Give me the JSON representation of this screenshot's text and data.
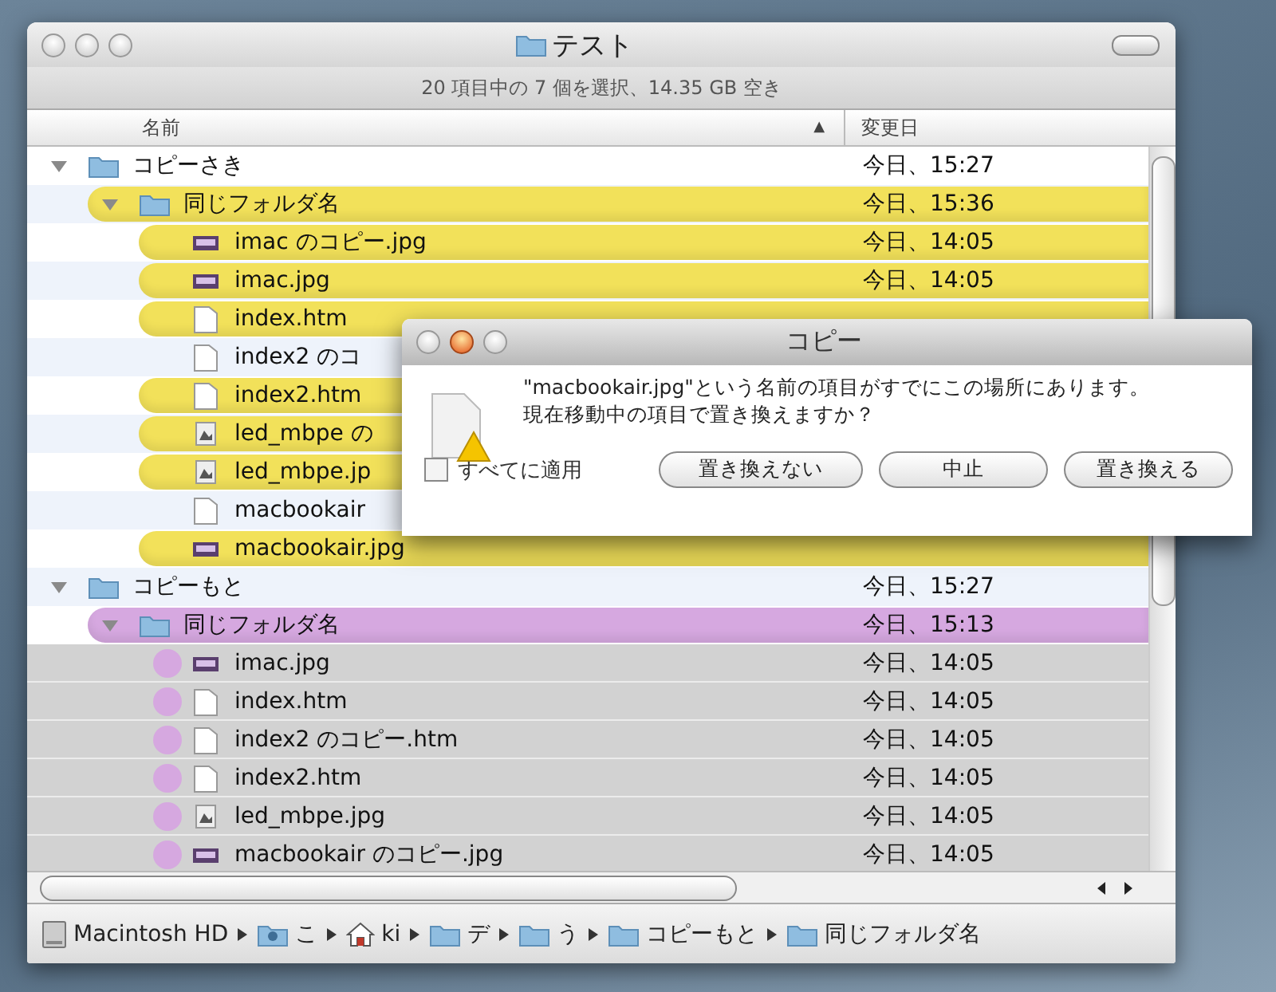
{
  "window": {
    "title": "テスト"
  },
  "status_text": "20 項目中の 7 個を選択、14.35 GB 空き",
  "columns": [
    {
      "label": "名前",
      "sort_indicator": "▲"
    },
    {
      "label": "変更日"
    }
  ],
  "rows": [
    {
      "name": "コピーさき",
      "date": "今日、15:27",
      "kind": "folder",
      "expanded": true,
      "selected": false,
      "children": [
        {
          "name": "同じフォルダ名",
          "date": "今日、15:36",
          "kind": "folder",
          "expanded": true,
          "selected": false,
          "color": "#f2e15a",
          "children": [
            {
              "name": "imac のコピー.jpg",
              "date": "今日、14:05",
              "kind": "image",
              "selected": false,
              "color": "#f2e15a"
            },
            {
              "name": "imac.jpg",
              "date": "今日、14:05",
              "kind": "image",
              "selected": false,
              "color": "#f2e15a"
            },
            {
              "name": "index.htm",
              "kind": "document",
              "selected": false,
              "color": "#f2e15a"
            },
            {
              "name": "index2 のコ",
              "kind": "document",
              "selected": false
            },
            {
              "name": "index2.htm",
              "kind": "document",
              "selected": false,
              "color": "#f2e15a"
            },
            {
              "name": "led_mbpe の",
              "kind": "photo",
              "selected": false,
              "color": "#f2e15a"
            },
            {
              "name": "led_mbpe.jp",
              "kind": "photo",
              "selected": false,
              "color": "#f2e15a"
            },
            {
              "name": "macbookair",
              "kind": "document",
              "selected": false
            },
            {
              "name": "macbookair.jpg",
              "kind": "image",
              "selected": false,
              "color": "#f2e15a"
            }
          ]
        }
      ]
    },
    {
      "name": "コピーもと",
      "date": "今日、15:27",
      "kind": "folder",
      "expanded": true,
      "selected": false,
      "children": [
        {
          "name": "同じフォルダ名",
          "date": "今日、15:13",
          "kind": "folder",
          "expanded": true,
          "selected": false,
          "color": "#d6a8e0",
          "children": [
            {
              "name": "imac.jpg",
              "date": "今日、14:05",
              "kind": "image",
              "selected": true,
              "color": "#d6a8e0"
            },
            {
              "name": "index.htm",
              "date": "今日、14:05",
              "kind": "document",
              "selected": true,
              "color": "#d6a8e0"
            },
            {
              "name": "index2 のコピー.htm",
              "date": "今日、14:05",
              "kind": "document",
              "selected": true,
              "color": "#d6a8e0"
            },
            {
              "name": "index2.htm",
              "date": "今日、14:05",
              "kind": "document",
              "selected": true,
              "color": "#d6a8e0"
            },
            {
              "name": "led_mbpe.jpg",
              "date": "今日、14:05",
              "kind": "photo",
              "selected": true,
              "color": "#d6a8e0"
            },
            {
              "name": "macbookair のコピー.jpg",
              "date": "今日、14:05",
              "kind": "image",
              "selected": true,
              "color": "#d6a8e0"
            }
          ]
        }
      ]
    }
  ],
  "path_bar": [
    {
      "kind": "disk",
      "label": "Macintosh HD"
    },
    {
      "kind": "user-folder",
      "label": "こ"
    },
    {
      "kind": "home",
      "label": "ki"
    },
    {
      "kind": "folder",
      "label": "デ"
    },
    {
      "kind": "folder",
      "label": "う"
    },
    {
      "kind": "folder",
      "label": "コピーもと"
    },
    {
      "kind": "folder",
      "label": "同じフォルダ名"
    }
  ],
  "dialog": {
    "title": "コピー",
    "message": "\"macbookair.jpg\"という名前の項目がすでにこの場所にあります。現在移動中の項目で置き換えますか？",
    "apply_all": {
      "label": "すべてに適用",
      "checked": false
    },
    "buttons": [
      "置き換えない",
      "中止",
      "置き換える"
    ]
  }
}
